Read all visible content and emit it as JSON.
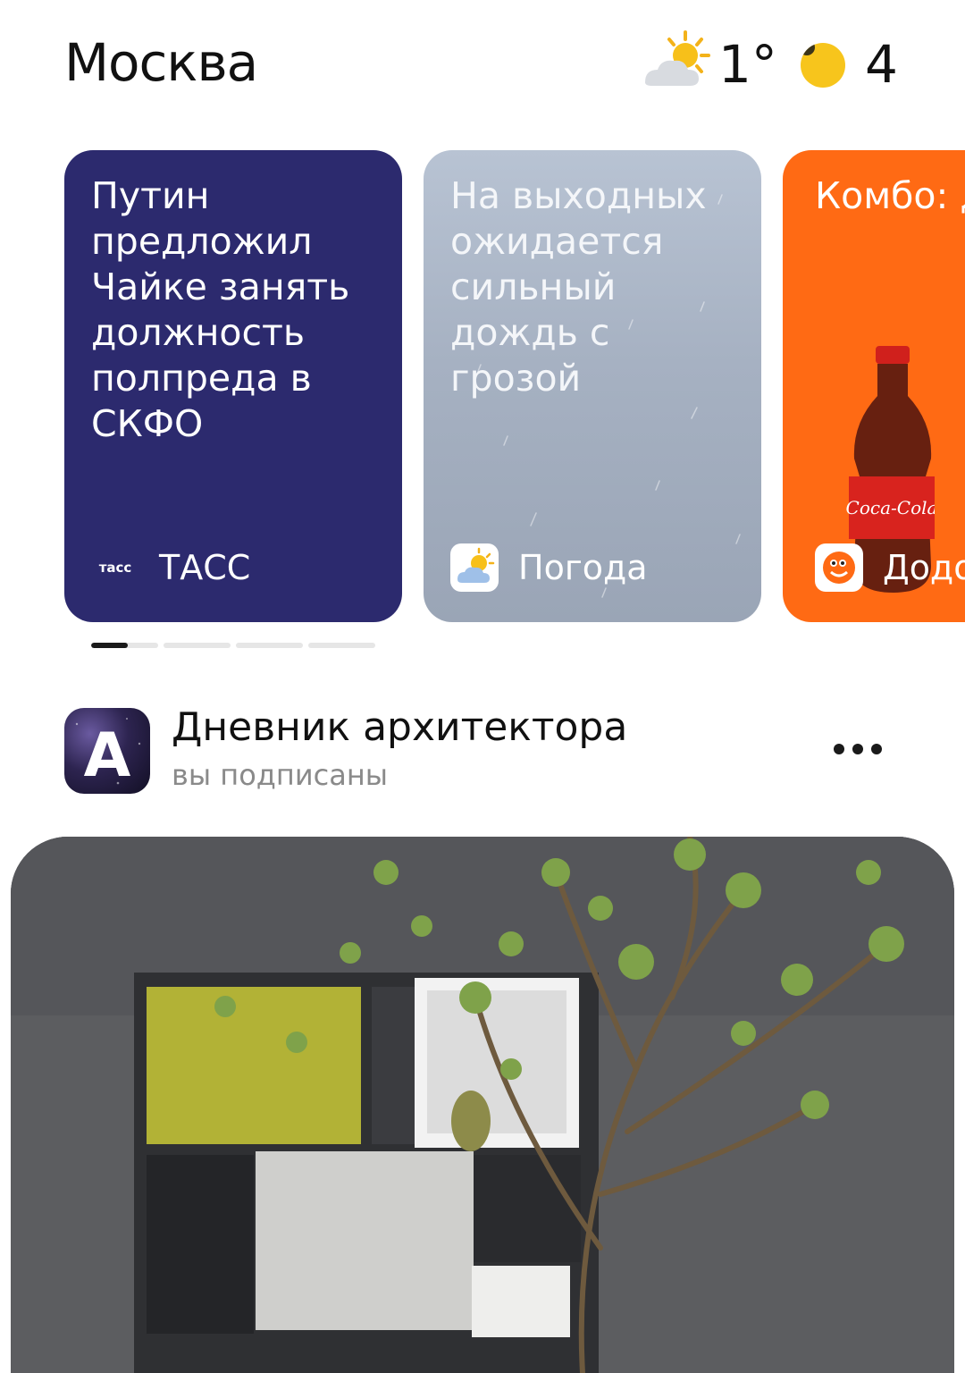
{
  "header": {
    "city": "Москва",
    "temperature": "1°",
    "traffic_score": "4",
    "weather_icon": "partly-cloudy-sun-icon"
  },
  "stories": [
    {
      "text": "Путин предложил Чайке занять должность полпреда в СКФО",
      "source": "ТАСС",
      "source_logo": "тасс",
      "bg": "#2c2a6e"
    },
    {
      "text": "На выходных ожидается сильный дождь с грозой",
      "source": "Погода",
      "bg": "#a9b4c4"
    },
    {
      "text": "Комбо: две пиццы и напиток",
      "source": "Додо",
      "bg": "#ff6a14"
    }
  ],
  "indicator_progress": 0.55,
  "channel": {
    "title": "Дневник архитектора",
    "subtitle": "вы подписаны",
    "avatar_letter": "А"
  },
  "colors": {
    "traffic_yellow": "#f7c51c",
    "dodo_orange": "#ff6a14",
    "tass_blue": "#2c2a6e"
  }
}
